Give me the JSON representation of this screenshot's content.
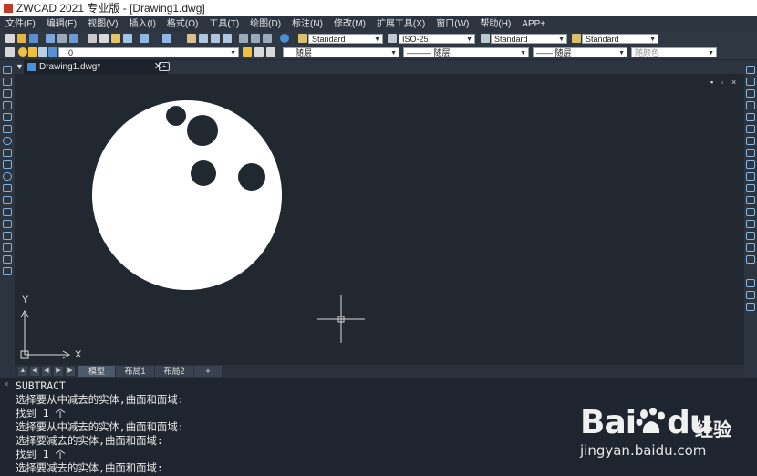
{
  "window": {
    "title": "ZWCAD 2021 专业版 - [Drawing1.dwg]"
  },
  "menu": [
    "文件(F)",
    "编辑(E)",
    "视图(V)",
    "插入(I)",
    "格式(O)",
    "工具(T)",
    "绘图(D)",
    "标注(N)",
    "修改(M)",
    "扩展工具(X)",
    "窗口(W)",
    "帮助(H)",
    "APP+"
  ],
  "toolbar": {
    "text_style": "Standard",
    "dim_style": "ISO-25",
    "table_style": "Standard",
    "multileader_style": "Standard",
    "layer": "0",
    "color": "随层",
    "linetype": "——— 随层",
    "lineweight": "—— 随层",
    "plotstyle": "随颜色"
  },
  "tabs": {
    "document": "Drawing1.dwg*",
    "close": "✕",
    "new": "+"
  },
  "canvas": {
    "background": "#212830",
    "axis_x": "X",
    "axis_y": "Y",
    "window_controls": [
      "▪",
      "▫",
      "×"
    ]
  },
  "layout_tabs": [
    "模型",
    "布局1",
    "布局2",
    "+"
  ],
  "command_lines": [
    "SUBTRACT",
    "选择要从中减去的实体,曲面和面域:",
    "找到 1 个",
    "选择要从中减去的实体,曲面和面域:",
    "选择要减去的实体,曲面和面域:",
    "找到 1 个",
    "选择要减去的实体,曲面和面域:"
  ],
  "watermark": {
    "brand_a": "Bai",
    "brand_b": "du",
    "jingyan": "经验",
    "url": "jingyan.baidu.com"
  }
}
